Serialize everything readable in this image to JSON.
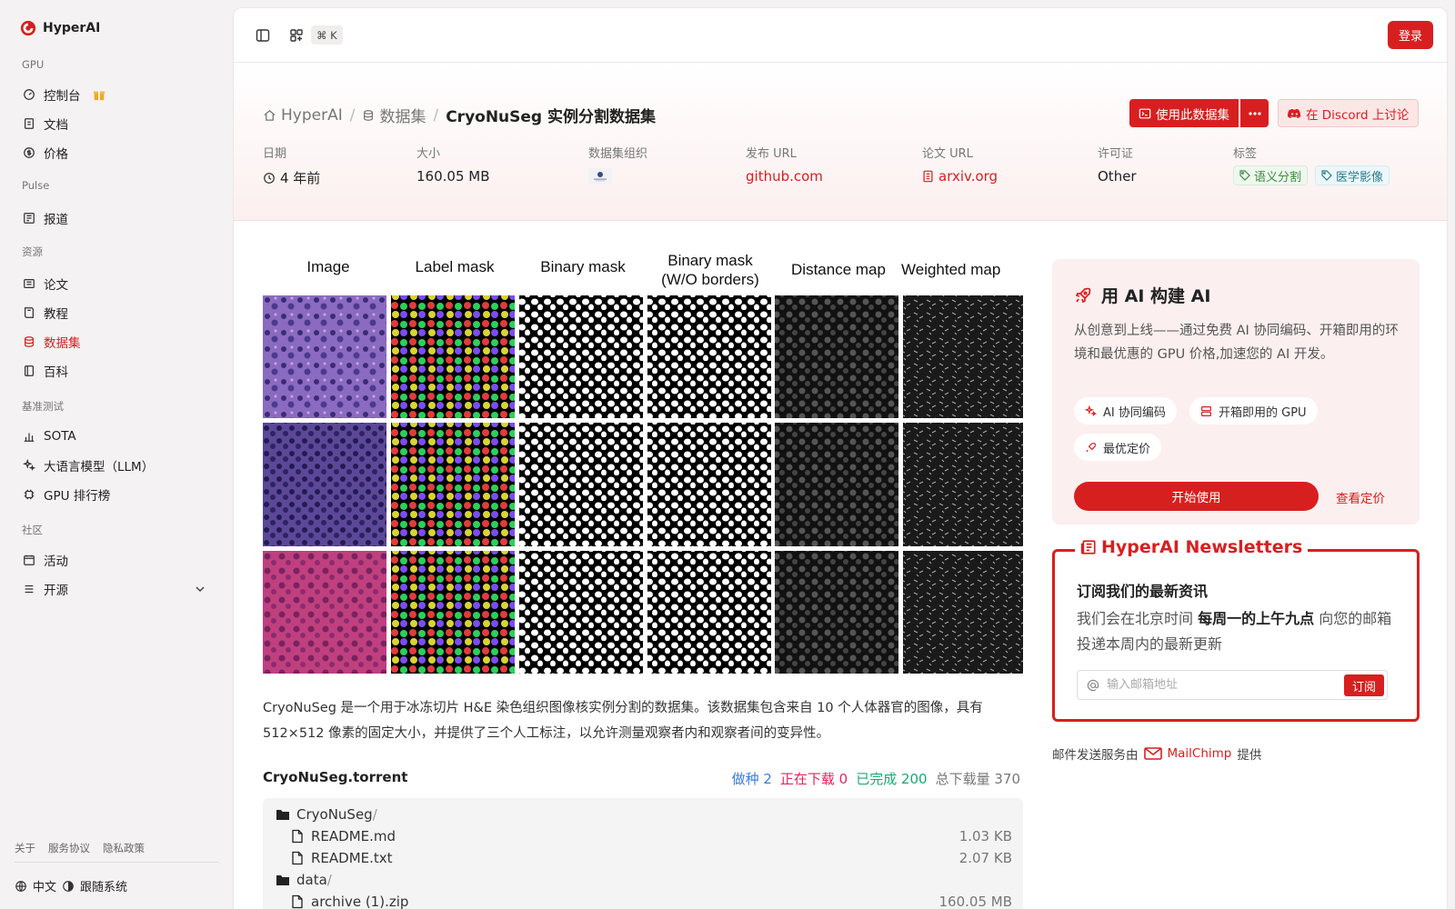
{
  "brand": {
    "name": "HyperAI"
  },
  "sidebar": {
    "sections": [
      {
        "title": "GPU",
        "items": [
          {
            "label": "控制台"
          },
          {
            "label": "文档"
          },
          {
            "label": "价格"
          }
        ]
      },
      {
        "title": "Pulse",
        "items": [
          {
            "label": "报道"
          }
        ]
      },
      {
        "title": "资源",
        "items": [
          {
            "label": "论文"
          },
          {
            "label": "教程"
          },
          {
            "label": "数据集",
            "active": true
          },
          {
            "label": "百科"
          }
        ]
      },
      {
        "title": "基准测试",
        "items": [
          {
            "label": "SOTA"
          },
          {
            "label": "大语言模型（LLM）"
          },
          {
            "label": "GPU 排行榜"
          }
        ]
      },
      {
        "title": "社区",
        "items": [
          {
            "label": "活动"
          },
          {
            "label": "开源"
          }
        ]
      }
    ],
    "footer_links": [
      "关于",
      "服务协议",
      "隐私政策"
    ],
    "language": "中文",
    "theme": "跟随系统"
  },
  "topbar": {
    "shortcut": "⌘ K",
    "login": "登录"
  },
  "breadcrumb": {
    "home": "HyperAI",
    "datasets": "数据集",
    "current": "CryoNuSeg 实例分割数据集"
  },
  "actions": {
    "use": "使用此数据集",
    "discord": "在 Discord 上讨论"
  },
  "meta": {
    "date": {
      "label": "日期",
      "value": "4 年前"
    },
    "size": {
      "label": "大小",
      "value": "160.05 MB"
    },
    "org": {
      "label": "数据集组织"
    },
    "url": {
      "label": "发布 URL",
      "value": "github.com"
    },
    "paper": {
      "label": "论文 URL",
      "value": "arxiv.org"
    },
    "license": {
      "label": "许可证",
      "value": "Other"
    },
    "tags": {
      "label": "标签",
      "values": [
        "语义分割",
        "医学影像"
      ]
    }
  },
  "figure": {
    "columns": [
      "Image",
      "Label mask",
      "Binary mask",
      "Binary mask",
      "(W/O borders)",
      "Distance map",
      "Weighted map"
    ]
  },
  "description": "CryoNuSeg 是一个用于冰冻切片 H&E 染色组织图像核实例分割的数据集。该数据集包含来自 10 个人体器官的图像，具有 512×512 像素的固定大小，并提供了三个人工标注，以允许测量观察者内和观察者间的变异性。",
  "torrent": {
    "title": "CryoNuSeg.torrent",
    "seeding": "做种 2",
    "downloading": "正在下载 0",
    "completed": "已完成 200",
    "total": "总下载量 370",
    "files": [
      {
        "name": "CryoNuSeg",
        "type": "folder",
        "depth": 0,
        "size": ""
      },
      {
        "name": "README.md",
        "type": "file",
        "depth": 1,
        "size": "1.03 KB"
      },
      {
        "name": "README.txt",
        "type": "file",
        "depth": 1,
        "size": "2.07 KB"
      },
      {
        "name": "data",
        "type": "folder",
        "depth": 0,
        "size": ""
      },
      {
        "name": "archive (1).zip",
        "type": "file",
        "depth": 1,
        "size": "160.05 MB"
      }
    ]
  },
  "promo": {
    "title": "用 AI 构建 AI",
    "text": "从创意到上线——通过免费 AI 协同编码、开箱即用的环境和最优惠的 GPU 价格,加速您的 AI 开发。",
    "chips": [
      "AI 协同编码",
      "开箱即用的 GPU",
      "最优定价"
    ],
    "start": "开始使用",
    "pricing": "查看定价"
  },
  "newsletter": {
    "title": "HyperAI Newsletters",
    "heading": "订阅我们的最新资讯",
    "text_before": "我们会在北京时间 ",
    "text_bold": "每周一的上午九点",
    "text_after": " 向您的邮箱投递本周内的最新更新",
    "placeholder": "输入邮箱地址",
    "subscribe": "订阅",
    "provider_prefix": "邮件发送服务由",
    "provider": "MailChimp",
    "provider_suffix": "提供"
  },
  "colors": {
    "accent": "#d81f1f",
    "sidebar_bg": "#f4f2f2",
    "hero_bg": "#fcefef"
  }
}
